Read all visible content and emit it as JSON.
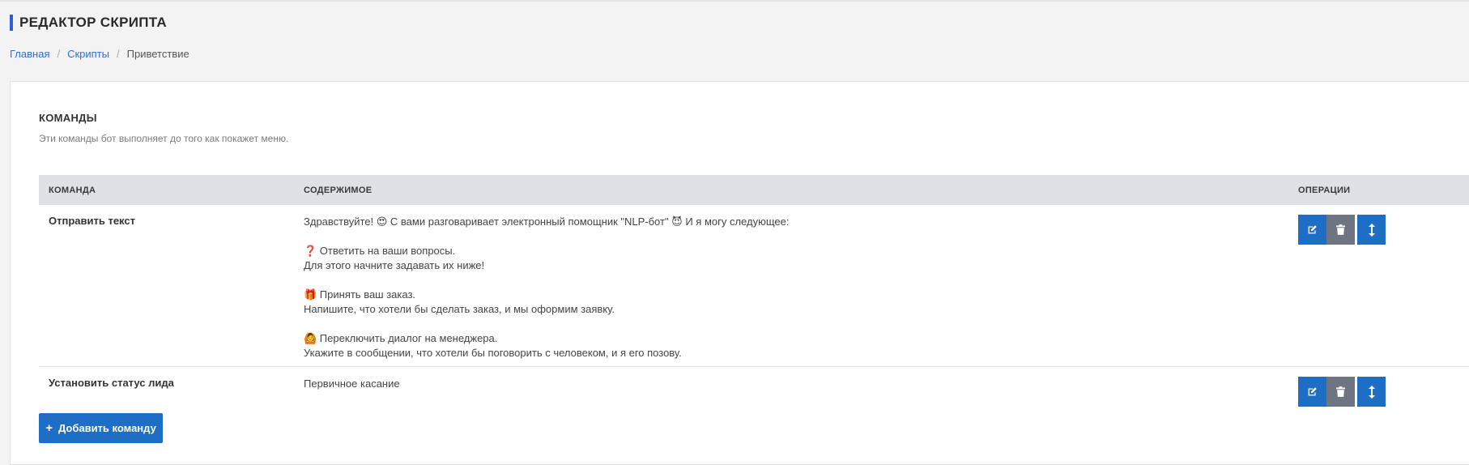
{
  "header": {
    "title": "РЕДАКТОР СКРИПТА"
  },
  "breadcrumb": {
    "home": "Главная",
    "scripts": "Скрипты",
    "current": "Приветствие",
    "separator": "/"
  },
  "section": {
    "title": "КОМАНДЫ",
    "description": "Эти команды бот выполняет до того как покажет меню."
  },
  "table": {
    "headers": {
      "command": "КОМАНДА",
      "content": "СОДЕРЖИМОЕ",
      "operations": "ОПЕРАЦИИ"
    },
    "rows": [
      {
        "command": "Отправить текст",
        "content": {
          "line1": "Здравствуйте! 😍 С вами разговаривает электронный помощник \"NLP-бот\" 😈 И я могу следующее:",
          "line2": "❓ Ответить на ваши вопросы.",
          "line3": "Для этого начните задавать их ниже!",
          "line4": "🎁 Принять ваш заказ.",
          "line5": "Напишите, что хотели бы сделать заказ, и мы оформим заявку.",
          "line6": "🙆 Переключить диалог на менеджера.",
          "line7": "Укажите в сообщении, что хотели бы поговорить с человеком, и я его позову."
        }
      },
      {
        "command": "Установить статус лида",
        "content": {
          "line1": "Первичное касание"
        }
      }
    ]
  },
  "buttons": {
    "add_command": "Добавить команду",
    "add_icon": "+"
  },
  "icons": {
    "edit": "edit-icon",
    "delete": "trash-icon",
    "move": "arrows-vertical-icon"
  },
  "colors": {
    "accent": "#1f6ec5",
    "delete": "#6d7580",
    "header_bar": "#2f5fd0",
    "table_header": "#dfe1e6"
  }
}
